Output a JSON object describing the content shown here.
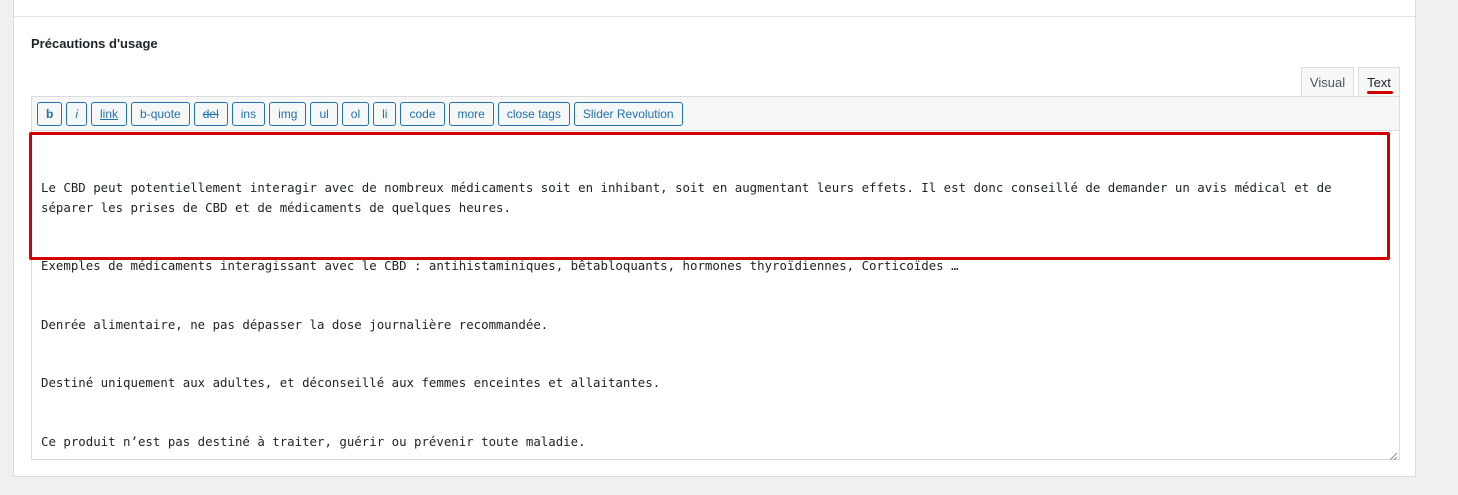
{
  "field": {
    "label": "Précautions d'usage"
  },
  "tabs": {
    "visual": "Visual",
    "text": "Text",
    "active": "text"
  },
  "toolbar": {
    "buttons": [
      "b",
      "i",
      "link",
      "b-quote",
      "del",
      "ins",
      "img",
      "ul",
      "ol",
      "li",
      "code",
      "more",
      "close tags",
      "Slider Revolution"
    ]
  },
  "content": {
    "lines": [
      "Le CBD peut potentiellement interagir avec de nombreux médicaments soit en inhibant, soit en augmentant leurs effets. Il est donc conseillé de demander un avis médical et de séparer les prises de CBD et de médicaments de quelques heures.",
      "Exemples de médicaments interagissant avec le CBD : antihistaminiques, bêtabloquants, hormones thyroïdiennes, Corticoïdes …",
      "Denrée alimentaire, ne pas dépasser la dose journalière recommandée.",
      "Destiné uniquement aux adultes, et déconseillé aux femmes enceintes et allaitantes.",
      "Ce produit n’est pas destiné à traiter, guérir ou prévenir toute maladie."
    ]
  },
  "colors": {
    "highlight": "#d40000",
    "button_accent": "#2271b1"
  }
}
